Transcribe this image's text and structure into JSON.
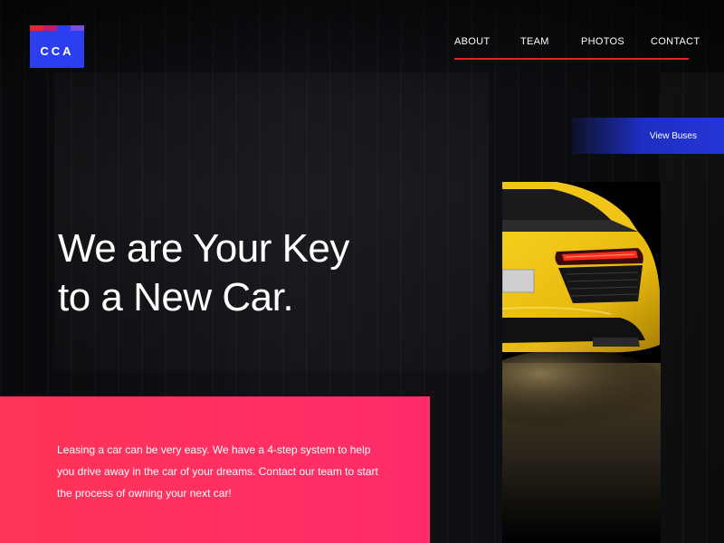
{
  "brand": {
    "logo_text": "CCA",
    "logo_color": "#2c3ff0",
    "stripe_colors": [
      "#e2262f",
      "#b8206f",
      "#2c3ff0",
      "#7a4de0"
    ]
  },
  "nav": {
    "items": [
      {
        "label": "ABOUT"
      },
      {
        "label": "TEAM"
      },
      {
        "label": "PHOTOS"
      },
      {
        "label": "CONTACT"
      }
    ],
    "underline_color": "#e0262b"
  },
  "cta": {
    "view_label": "View Buses"
  },
  "hero": {
    "line1": "We are Your Key",
    "line2": "to a New Car."
  },
  "info": {
    "text": "Leasing a car can be very easy. We have a 4-step system to help you drive away in the car of your dreams. Contact our team to start the process of owning your next car!",
    "color": "#ff3457"
  },
  "image": {
    "icon": "yellow-sports-car-image"
  }
}
